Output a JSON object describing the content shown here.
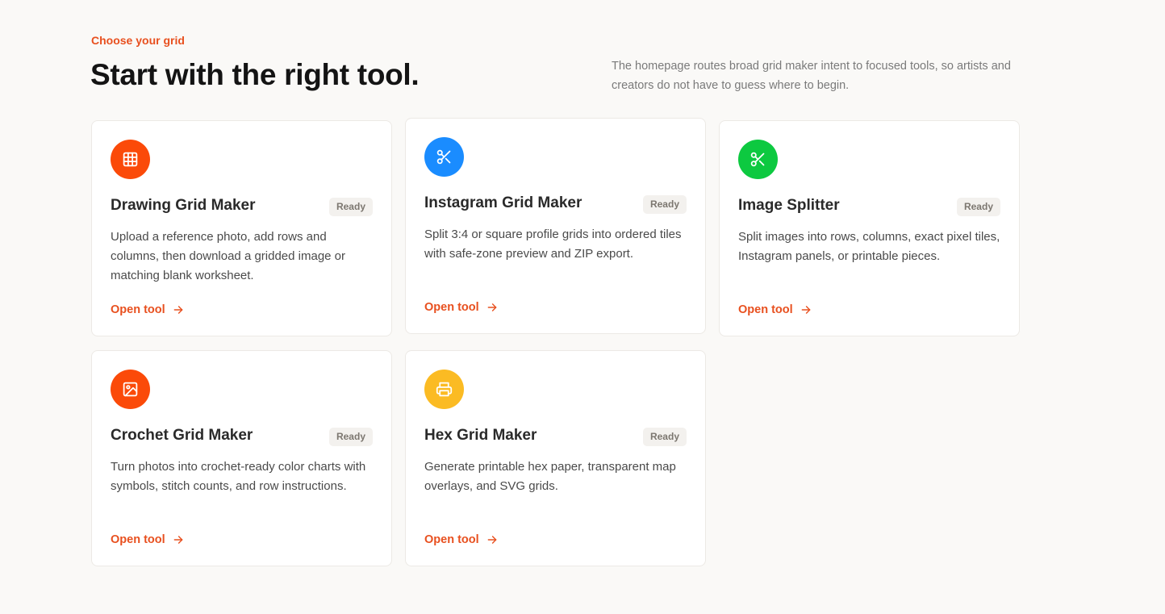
{
  "header": {
    "eyebrow": "Choose your grid",
    "title": "Start with the right tool.",
    "intro": "The homepage routes broad grid maker intent to focused tools, so artists and creators do not have to guess where to begin."
  },
  "colors": {
    "accent": "#e8501f",
    "orange_red": "#fb4a09",
    "blue": "#1a8cff",
    "green": "#0dc940",
    "yellow": "#fbbb23"
  },
  "cards": [
    {
      "title": "Drawing Grid Maker",
      "badge": "Ready",
      "description": "Upload a reference photo, add rows and columns, then download a gridded image or matching blank worksheet.",
      "link": "Open tool",
      "icon": "grid-icon",
      "color": "#fb4a09"
    },
    {
      "title": "Instagram Grid Maker",
      "badge": "Ready",
      "description": "Split 3:4 or square profile grids into ordered tiles with safe-zone preview and ZIP export.",
      "link": "Open tool",
      "icon": "scissors-icon",
      "color": "#1a8cff"
    },
    {
      "title": "Image Splitter",
      "badge": "Ready",
      "description": "Split images into rows, columns, exact pixel tiles, Instagram panels, or printable pieces.",
      "link": "Open tool",
      "icon": "scissors-icon",
      "color": "#0dc940"
    },
    {
      "title": "Crochet Grid Maker",
      "badge": "Ready",
      "description": "Turn photos into crochet-ready color charts with symbols, stitch counts, and row instructions.",
      "link": "Open tool",
      "icon": "image-icon",
      "color": "#fb4a09"
    },
    {
      "title": "Hex Grid Maker",
      "badge": "Ready",
      "description": "Generate printable hex paper, transparent map overlays, and SVG grids.",
      "link": "Open tool",
      "icon": "printer-icon",
      "color": "#fbbb23"
    }
  ]
}
